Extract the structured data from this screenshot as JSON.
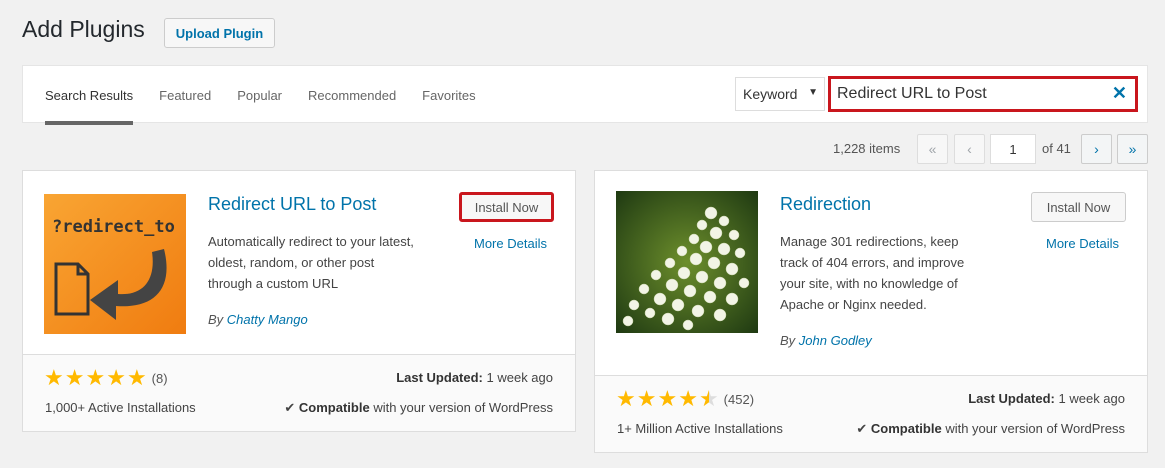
{
  "header": {
    "title": "Add Plugins",
    "upload_label": "Upload Plugin"
  },
  "tabs": [
    {
      "label": "Search Results",
      "active": true
    },
    {
      "label": "Featured"
    },
    {
      "label": "Popular"
    },
    {
      "label": "Recommended"
    },
    {
      "label": "Favorites"
    }
  ],
  "search": {
    "type_selected": "Keyword",
    "query": "Redirect URL to Post",
    "clear_icon": "close-icon"
  },
  "pagination": {
    "items": "1,228 items",
    "first": "«",
    "prev": "‹",
    "current": "1",
    "of": "of 41",
    "next": "›",
    "last": "»"
  },
  "plugins": [
    {
      "name": "Redirect URL to Post",
      "icon_text": "?redirect_to",
      "install_label": "Install Now",
      "more_details": "More Details",
      "description": "Automatically redirect to your latest, oldest, random, or other post through a custom URL",
      "author_prefix": "By",
      "author": "Chatty Mango",
      "rating": 5,
      "rating_count": "(8)",
      "installs": "1,000+ Active Installations",
      "updated_label": "Last Updated:",
      "updated_value": "1 week ago",
      "compat_label": "Compatible",
      "compat_rest": "with your version of WordPress"
    },
    {
      "name": "Redirection",
      "install_label": "Install Now",
      "more_details": "More Details",
      "description": "Manage 301 redirections, keep track of 404 errors, and improve your site, with no knowledge of Apache or Nginx needed.",
      "author_prefix": "By",
      "author": "John Godley",
      "rating": 4.5,
      "rating_count": "(452)",
      "installs": "1+ Million Active Installations",
      "updated_label": "Last Updated:",
      "updated_value": "1 week ago",
      "compat_label": "Compatible",
      "compat_rest": "with your version of WordPress"
    }
  ],
  "colors": {
    "accent": "#0073aa",
    "highlight": "#c9161d",
    "star": "#ffb900",
    "icon_orange": "#f7941d"
  }
}
